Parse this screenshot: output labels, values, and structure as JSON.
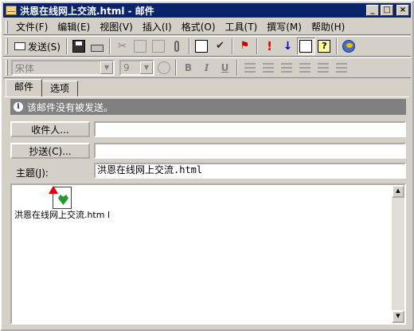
{
  "window": {
    "title": "洪恩在线网上交流.html - 邮件",
    "controls": {
      "minimize": "_",
      "maximize": "□",
      "close": "×"
    }
  },
  "menu": [
    "文件(F)",
    "编辑(E)",
    "视图(V)",
    "插入(I)",
    "格式(O)",
    "工具(T)",
    "撰写(M)",
    "帮助(H)"
  ],
  "toolbar": {
    "send_label": "发送(S)",
    "icons": [
      "save-icon",
      "print-icon",
      "cut-icon",
      "copy-icon",
      "paste-icon",
      "attach-icon",
      "address-book-icon",
      "check-names-icon",
      "flag-icon",
      "high-priority-icon",
      "low-priority-icon",
      "message-card-icon",
      "help-icon",
      "encode-icon"
    ]
  },
  "format_bar": {
    "font_name": "宋体",
    "font_size": "9",
    "bold": "B",
    "italic": "I",
    "underline": "U"
  },
  "tabs": [
    "邮件",
    "选项"
  ],
  "info": {
    "message": "该邮件没有被发送。"
  },
  "fields": {
    "to_label": "收件人...",
    "cc_label": "抄送(C)...",
    "subject_label": "主题(J):",
    "to_value": "",
    "cc_value": "",
    "subject_value": "洪恩在线网上交流.html"
  },
  "attachment": {
    "name": "洪恩在线网上交流.htm l"
  },
  "scrollbar": {
    "up": "▲",
    "down": "▼"
  },
  "colors": {
    "titlebar": "#0a246a",
    "infobar": "#808080",
    "window": "#d4d0c8"
  }
}
